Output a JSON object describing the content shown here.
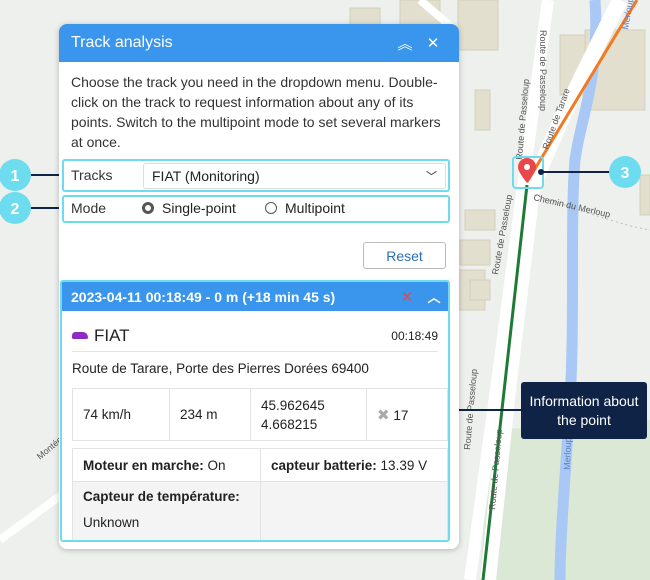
{
  "map": {
    "streets": [
      "Route de Passeloup",
      "Route de Tarare",
      "Route de Passeloup",
      "Chemin du Merloup",
      "Route de Passeloup",
      "Merloup",
      "Merloup",
      "Montée",
      "Route de Passeloup",
      "Route de Passeloup"
    ],
    "colors": {
      "track_before": "#f47a22",
      "track_after": "#1f7a35",
      "marker": "#e8474b",
      "river": "#a9c8f5",
      "park": "#dbe8d6"
    }
  },
  "panel": {
    "title": "Track analysis",
    "collapse_icon": "double-chevron-up-icon",
    "close_icon": "close-icon",
    "description": "Choose the track you need in the dropdown menu. Double-click on the track to request information about any of its points. Switch to the multipoint mode to set several markers at once.",
    "tracks_label": "Tracks",
    "tracks_value": "FIAT (Monitoring)",
    "mode_label": "Mode",
    "mode_options": [
      "Single-point",
      "Multipoint"
    ],
    "mode_selected": "Single-point",
    "reset_label": "Reset"
  },
  "point": {
    "header": "2023-04-11 00:18:49 - 0 m (+18 min 45 s)",
    "unit_name": "FIAT",
    "time": "00:18:49",
    "address": "Route de Tarare, Porte des Pierres Dorées 69400",
    "speed": "74 km/h",
    "altitude": "234 m",
    "lat": "45.962645",
    "lon": "4.668215",
    "satellites": "17",
    "sensors": [
      {
        "name": "Moteur en marche:",
        "value": "On"
      },
      {
        "name": "capteur batterie:",
        "value": "13.39 V"
      },
      {
        "name": "Capteur de température:",
        "value": "Unknown"
      }
    ]
  },
  "callouts": {
    "c1": "1",
    "c2": "2",
    "c3": "3",
    "info": "Information about the point",
    "accent": "#6edcef",
    "info_bg": "#0f2346"
  }
}
